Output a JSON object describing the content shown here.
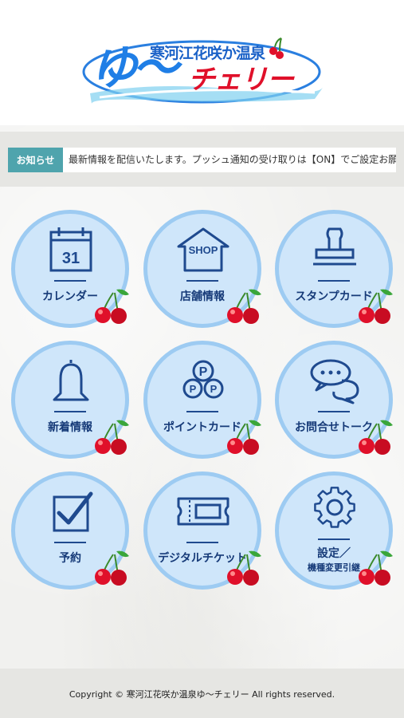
{
  "header": {
    "logo_subtitle": "寒河江花咲か温泉",
    "logo_yu": "ゆ〜",
    "logo_cherry": "チェリー"
  },
  "news": {
    "badge": "お知らせ",
    "text": "最新情報を配信いたします。プッシュ通知の受け取りは【ON】でご設定お願いします。"
  },
  "menu": {
    "calendar": {
      "label": "カレンダー",
      "day": "31"
    },
    "shop": {
      "label": "店舗情報",
      "sign": "SHOP"
    },
    "stamp": {
      "label": "スタンプカード"
    },
    "news": {
      "label": "新着情報"
    },
    "points": {
      "label": "ポイントカード"
    },
    "contact": {
      "label": "お問合せトーク"
    },
    "reserve": {
      "label": "予約"
    },
    "ticket": {
      "label": "デジタルチケット"
    },
    "settings": {
      "label": "設定／",
      "sublabel": "機種変更引継"
    }
  },
  "footer": {
    "copyright": "Copyright © 寒河江花咲か温泉ゆ〜チェリー All rights reserved."
  },
  "colors": {
    "badge": "#4fa4ad",
    "tile_fill": "#cfe6fa",
    "tile_border": "#9dcbf2",
    "label": "#163a78",
    "cherry": "#e0102a"
  }
}
